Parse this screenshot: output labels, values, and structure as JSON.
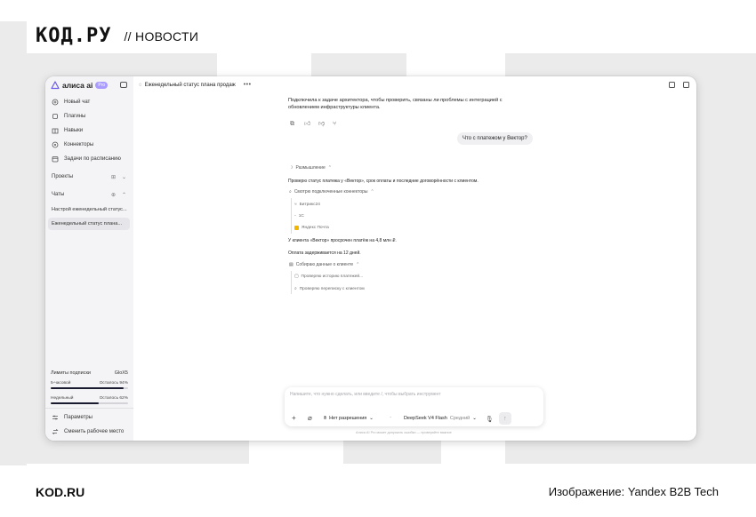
{
  "site": {
    "logo": "КОД.РУ",
    "section": "// НОВОСТИ",
    "footer_brand": "KOD.RU",
    "footer_credit": "Изображение: Yandex B2B Tech"
  },
  "app": {
    "brand": "алиса ai",
    "badge": "Pro",
    "chat_title": "Еженедельный статус плана продаж",
    "more": "•••"
  },
  "sidebar": {
    "items": [
      {
        "label": "Новый чат",
        "icon": "new-chat-icon"
      },
      {
        "label": "Плагины",
        "icon": "plugins-icon"
      },
      {
        "label": "Навыки",
        "icon": "skills-icon"
      },
      {
        "label": "Коннекторы",
        "icon": "connectors-icon"
      },
      {
        "label": "Задачи по расписанию",
        "icon": "schedule-icon"
      }
    ],
    "projects_label": "Проекты",
    "chats_label": "Чаты",
    "chats": [
      {
        "label": "Настрой еженедельный статус..."
      },
      {
        "label": "Еженедельный статус плана..."
      }
    ],
    "limits": {
      "title": "Лимиты подписки",
      "plan": "GloX5",
      "rows": [
        {
          "label": "5-часовой",
          "remain": "Осталось 94%",
          "fill": 0.94
        },
        {
          "label": "Недельный",
          "remain": "Осталось 62%",
          "fill": 0.62
        }
      ]
    },
    "settings": "Параметры",
    "switch_workspace": "Сменить рабочее место"
  },
  "conversation": {
    "assistant_text": "Подключила к задаче архитектора, чтобы проверить, связаны ли проблемы с интеграцией с обновлением инфраструктуры клиента.",
    "user_message": "Что с платежом у Вектор?",
    "thinking_label": "Размышление",
    "thinking_intro": "Проверю статус платежа у «Вектор», срок оплаты и последние договорённости с клиентом.",
    "connectors_step": "Смотрю подключенные коннекторы",
    "connectors": [
      "Битрикс24",
      "1С",
      "Яндекс Почта"
    ],
    "finding_1": "У клиента «Вектор» просрочен платёж на 4,8 млн ₽.",
    "finding_2": "Оплата задерживается на 12 дней.",
    "collect_step": "Собираю данные о клиенте",
    "collect_items": [
      "Проверяю историю платежей...",
      "Проверяю переписку с клиентом"
    ]
  },
  "composer": {
    "placeholder": "Напишите, что нужно сделать, или введите /, чтобы выбрать инструмент",
    "permissions": "Нет разрешения",
    "model": "DeepSeek V4 Flash",
    "level": "Средний",
    "disclaimer": "Алиса AI Pro может допускать ошибки — проверяйте важное"
  }
}
